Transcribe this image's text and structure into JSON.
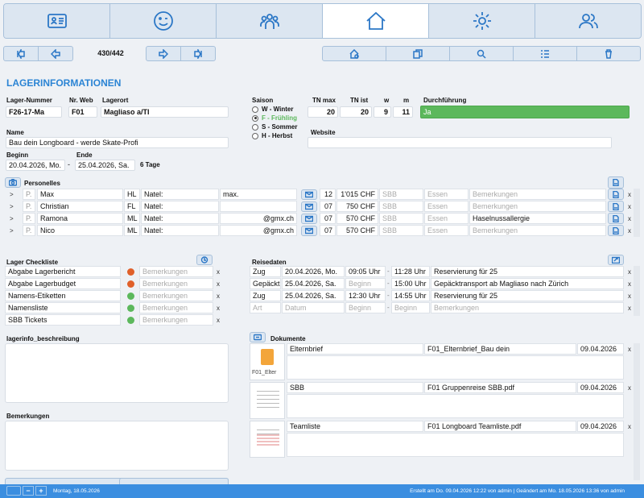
{
  "nav": {
    "tabs": [
      "card-icon",
      "smiley-icon",
      "group-icon",
      "home-icon",
      "gear-icon",
      "users-icon"
    ],
    "active": 3
  },
  "toolbar": {
    "counter": "430/442"
  },
  "page_title": "LAGERINFORMATIONEN",
  "labels": {
    "lager_nummer": "Lager-Nummer",
    "nr_web": "Nr. Web",
    "lagerort": "Lagerort",
    "saison": "Saison",
    "tn_max": "TN max",
    "tn_ist": "TN ist",
    "w": "w",
    "m": "m",
    "durchfuehrung": "Durchführung",
    "name": "Name",
    "website": "Website",
    "beginn": "Beginn",
    "ende": "Ende",
    "personelles": "Personelles",
    "lager_checkliste": "Lager Checkliste",
    "reisedaten": "Reisedaten",
    "beschreibung": "lagerinfo_beschreibung",
    "bemerkungen": "Bemerkungen",
    "dokumente": "Dokumente"
  },
  "lager": {
    "nummer": "F26-17-Ma",
    "nr_web": "F01",
    "lagerort": "Magliaso a/TI",
    "tn_max": "20",
    "tn_ist": "20",
    "w": "9",
    "m": "11",
    "durchfuehrung": "Ja",
    "name": "Bau dein Longboard - werde Skate-Profi",
    "beginn": "20.04.2026, Mo.",
    "dash": "-",
    "ende": "25.04.2026, Sa.",
    "dauer": "6 Tage"
  },
  "saison": [
    {
      "label": "W - Winter",
      "checked": false
    },
    {
      "label": "F - Frühling",
      "checked": true
    },
    {
      "label": "S - Sommer",
      "checked": false
    },
    {
      "label": "H - Herbst",
      "checked": false
    }
  ],
  "personelles": {
    "placeholders": {
      "sbb": "SBB",
      "essen": "Essen",
      "bemerkungen": "Bemerkungen"
    },
    "rows": [
      {
        "arrow": ">",
        "p": "P.",
        "name": "Max",
        "role": "HL",
        "natel": "Natel:",
        "email": "max.",
        "n": "12",
        "chf": "1'015 CHF",
        "note": ""
      },
      {
        "arrow": ">",
        "p": "P.",
        "name": "Christian",
        "role": "FL",
        "natel": "Natel:",
        "email": "",
        "n": "07",
        "chf": "750 CHF",
        "note": ""
      },
      {
        "arrow": ">",
        "p": "P.",
        "name": "Ramona",
        "role": "ML",
        "natel": "Natel:",
        "email": "@gmx.ch",
        "n": "07",
        "chf": "570 CHF",
        "note": "Haselnussallergie"
      },
      {
        "arrow": ">",
        "p": "P.",
        "name": "Nico",
        "role": "ML",
        "natel": "Natel:",
        "email": "@gmx.ch",
        "n": "07",
        "chf": "570 CHF",
        "note": ""
      }
    ]
  },
  "checkliste": {
    "placeholder": "Bemerkungen",
    "items": [
      {
        "label": "Abgabe Lagerbericht",
        "status": "open",
        "color": "#e0602a"
      },
      {
        "label": "Abgabe Lagerbudget",
        "status": "open",
        "color": "#e0602a"
      },
      {
        "label": "Namens-Etiketten",
        "status": "done",
        "color": "#5cb85c"
      },
      {
        "label": "Namensliste",
        "status": "done",
        "color": "#5cb85c"
      },
      {
        "label": "SBB Tickets",
        "status": "done",
        "color": "#5cb85c"
      }
    ]
  },
  "reisedaten": {
    "rows": [
      {
        "art": "Zug",
        "datum": "20.04.2026, Mo.",
        "von": "09:05 Uhr",
        "dash": "-",
        "bis": "11:28 Uhr",
        "text": "Reservierung für 25"
      },
      {
        "art": "Gepäckt",
        "datum": "25.04.2026, Sa.",
        "von": "Beginn",
        "dash": "-",
        "bis": "15:00 Uhr",
        "text": "Gepäcktransport ab Magliaso nach Zürich"
      },
      {
        "art": "Zug",
        "datum": "25.04.2026, Sa.",
        "von": "12:30 Uhr",
        "dash": "-",
        "bis": "14:55 Uhr",
        "text": "Reservierung für 25"
      },
      {
        "art": "Art",
        "datum": "Datum",
        "von": "Beginn",
        "dash": "-",
        "bis": "Beginn",
        "text": "Bemerkungen"
      }
    ]
  },
  "dokumente": [
    {
      "thumb_label": "F01_Elter",
      "name": "Elternbrief",
      "file": "F01_Elternbrief_Bau dein",
      "date": "09.04.2026"
    },
    {
      "thumb_label": "",
      "name": "SBB",
      "file": "F01 Gruppenreise SBB.pdf",
      "date": "09.04.2026"
    },
    {
      "thumb_label": "",
      "name": "Teamliste",
      "file": "F01 Longboard Teamliste.pdf",
      "date": "09.04.2026"
    }
  ],
  "x_glyph": "x",
  "status": {
    "minus": "−",
    "plus": "+",
    "date": "Montag, 18.05.2026",
    "info": "Erstellt am Do. 09.04.2026 12:22 von admin | Geändert am Mo. 18.05.2026 13:36 von admin"
  },
  "colors": {
    "accent": "#2b84d4",
    "durchfuehrung": "#5cb85c",
    "statusbar": "#3b8ee0",
    "open": "#e0602a",
    "done": "#5cb85c"
  }
}
